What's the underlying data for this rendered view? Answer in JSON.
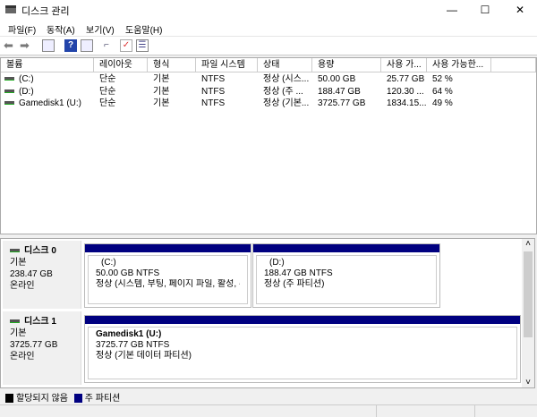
{
  "window": {
    "title": "디스크 관리",
    "minimize": "—",
    "maximize": "☐",
    "close": "✕"
  },
  "menu": [
    "파일(F)",
    "동작(A)",
    "보기(V)",
    "도움말(H)"
  ],
  "toolbar": [
    "back-icon",
    "forward-icon",
    "console-tree-icon",
    "help-icon",
    "properties-icon",
    "connect-icon",
    "check-icon",
    "list-icon"
  ],
  "columns": [
    "볼륨",
    "레이아웃",
    "형식",
    "파일 시스템",
    "상태",
    "용량",
    "사용 가...",
    "사용 가능한..."
  ],
  "volumes": [
    [
      "(C:)",
      "단순",
      "기본",
      "NTFS",
      "정상 (시스...",
      "50.00 GB",
      "25.77 GB",
      "52 %"
    ],
    [
      "(D:)",
      "단순",
      "기본",
      "NTFS",
      "정상 (주 ...",
      "188.47 GB",
      "120.30 ...",
      "64 %"
    ],
    [
      "Gamedisk1 (U:)",
      "단순",
      "기본",
      "NTFS",
      "정상 (기본...",
      "3725.77 GB",
      "1834.15...",
      "49 %"
    ]
  ],
  "disks": [
    {
      "name": "디스크 0",
      "type": "기본",
      "size": "238.47 GB",
      "status": "온라인",
      "partitions": [
        {
          "name": "(C:)",
          "size": "50.00 GB NTFS",
          "status": "정상 (시스템, 부팅, 페이지 파일, 활성, 주"
        },
        {
          "name": "(D:)",
          "size": "188.47 GB NTFS",
          "status": "정상 (주 파티션)"
        }
      ]
    },
    {
      "name": "디스크 1",
      "type": "기본",
      "size": "3725.77 GB",
      "status": "온라인",
      "partitions": [
        {
          "name": "Gamedisk1  (U:)",
          "size": "3725.77 GB NTFS",
          "status": "정상 (기본 데이터 파티션)"
        }
      ]
    }
  ],
  "legend": [
    {
      "label": "할당되지 않음",
      "color": "#000000"
    },
    {
      "label": "주 파티션",
      "color": "#000080"
    }
  ],
  "scroll": {
    "up": "˄",
    "down": "˅"
  }
}
